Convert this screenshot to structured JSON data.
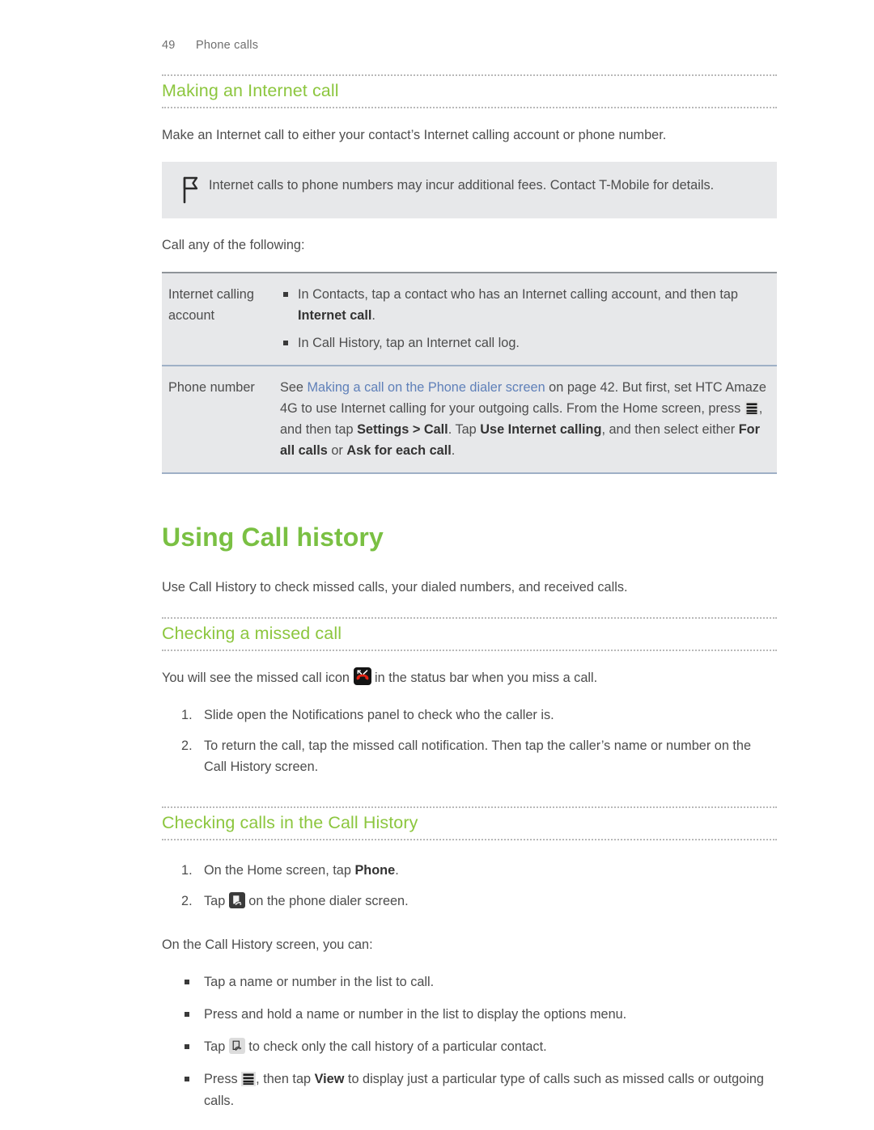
{
  "header": {
    "page_number": "49",
    "section": "Phone calls"
  },
  "sections": {
    "making_internet_call": {
      "heading": "Making an Internet call",
      "intro": "Make an Internet call to either your contact’s Internet calling account or phone number.",
      "note": {
        "icon": "flag-icon",
        "text": "Internet calls to phone numbers may incur additional fees. Contact T-Mobile for details."
      },
      "call_intro": "Call any of the following:",
      "table": {
        "rows": [
          {
            "label": "Internet calling account",
            "items": [
              {
                "prefix": "In Contacts, tap a contact who has an Internet calling account, and then tap ",
                "bold": "Internet call",
                "suffix": "."
              },
              {
                "prefix": "In Call History, tap an Internet call log.",
                "bold": "",
                "suffix": ""
              }
            ]
          },
          {
            "label": "Phone number",
            "text_parts": {
              "p1": "See ",
              "link": "Making a call on the Phone dialer screen",
              "p2": " on page 42. But first, set HTC Amaze 4G to use Internet calling for your outgoing calls. From the Home screen, press ",
              "icon": "menu-icon",
              "p3": ", and then tap ",
              "b1": "Settings > Call",
              "p4": ". Tap ",
              "b2": "Use Internet calling",
              "p5": ", and then select either ",
              "b3": "For all calls",
              "p6": " or ",
              "b4": "Ask for each call",
              "p7": "."
            }
          }
        ]
      }
    },
    "using_call_history": {
      "heading": "Using Call history",
      "intro": "Use Call History to check missed calls, your dialed numbers, and received calls."
    },
    "checking_missed_call": {
      "heading": "Checking a missed call",
      "intro_parts": {
        "p1": "You will see the missed call icon ",
        "icon": "missed-call-icon",
        "p2": " in the status bar when you miss a call."
      },
      "steps": [
        "Slide open the Notifications panel to check who the caller is.",
        "To return the call, tap the missed call notification. Then tap the caller’s name or number on the Call History screen."
      ]
    },
    "checking_calls": {
      "heading": "Checking calls in the Call History",
      "steps": [
        {
          "p1": "On the Home screen, tap ",
          "bold": "Phone",
          "p2": "."
        },
        {
          "p1": "Tap ",
          "icon": "call-history-icon",
          "p2": " on the phone dialer screen."
        }
      ],
      "screen_intro": "On the Call History screen, you can:",
      "bullets": [
        {
          "p1": "Tap a name or number in the list to call.",
          "icon": "",
          "bold": "",
          "p2": "",
          "p3": ""
        },
        {
          "p1": "Press and hold a name or number in the list to display the options menu.",
          "icon": "",
          "bold": "",
          "p2": "",
          "p3": ""
        },
        {
          "p1": "Tap ",
          "icon": "call-history-icon",
          "bold": "",
          "p2": " to check only the call history of a particular contact.",
          "p3": ""
        },
        {
          "p1": "Press ",
          "icon": "menu-icon",
          "bold": "View",
          "p2": ", then tap ",
          "p3": " to display just a particular type of calls such as missed calls or outgoing calls."
        }
      ]
    }
  },
  "colors": {
    "green_heading": "#8cc63e",
    "green_title": "#7ac043",
    "link_blue": "#5f80b9",
    "body_text": "#4d4d4d",
    "panel_bg": "#e7e8ea",
    "rule_dotted": "#b9b9b9",
    "table_border_top": "#8f9499",
    "table_border_blue": "#9fb0c6",
    "missed_call_red": "#e32213"
  }
}
